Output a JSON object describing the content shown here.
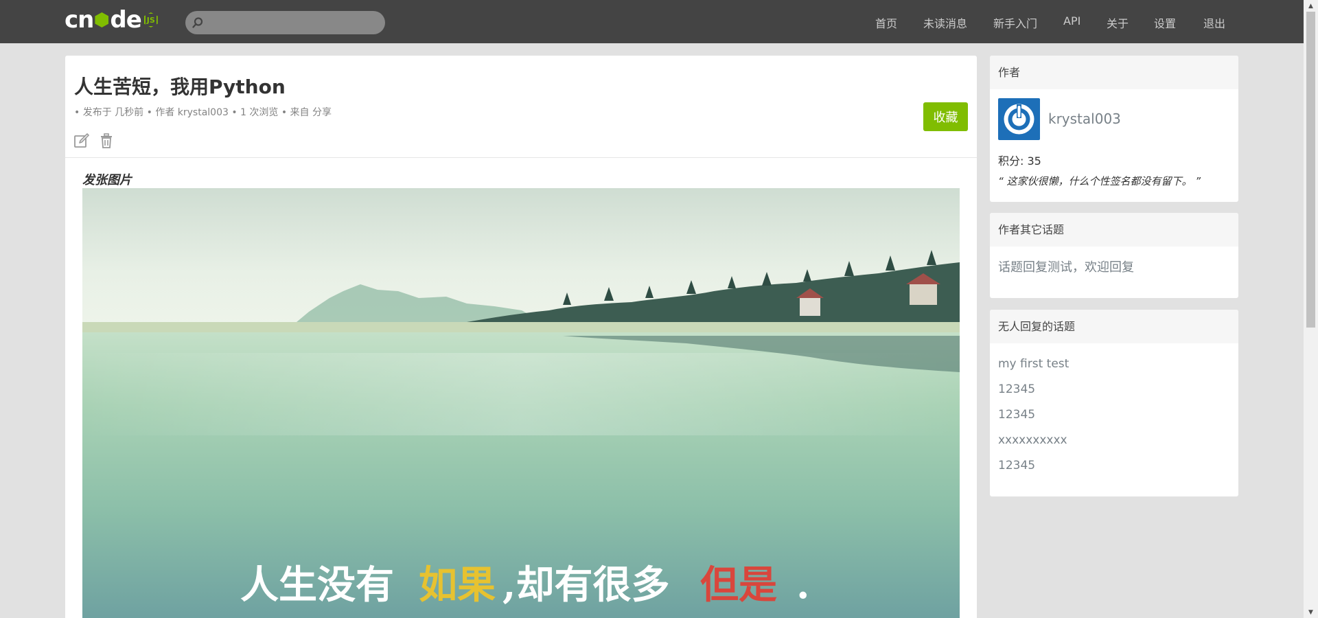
{
  "brand": {
    "logo_text": "cnode",
    "logo_suffix": "JS"
  },
  "search": {
    "placeholder": "",
    "value": ""
  },
  "nav": {
    "items": [
      "首页",
      "未读消息",
      "新手入门",
      "API",
      "关于",
      "设置",
      "退出"
    ]
  },
  "topic": {
    "title": "人生苦短，我用Python",
    "meta": "• 发布于 几秒前 • 作者 krystal003 • 1 次浏览 • 来自 分享",
    "collect_label": "收藏",
    "content_heading": "发张图片",
    "image_caption": {
      "part1": "人生没有",
      "part2": "如果",
      "part3": ",却有很多",
      "part4": "但是",
      "part5": "."
    }
  },
  "sidebar": {
    "author": {
      "header": "作者",
      "name": "krystal003",
      "score": "积分: 35",
      "signature": "“ 这家伙很懒，什么个性签名都没有留下。 ”"
    },
    "other_topics": {
      "header": "作者其它话题",
      "items": [
        "话题回复测试，欢迎回复"
      ]
    },
    "no_reply_topics": {
      "header": "无人回复的话题",
      "items": [
        "my first test",
        "12345",
        "12345",
        "xxxxxxxxxx",
        "12345"
      ]
    }
  },
  "colors": {
    "navbar_bg": "#444444",
    "accent_green": "#80bd01",
    "page_bg": "#e1e1e1",
    "panel_bg": "#ffffff",
    "link_gray": "#778087",
    "avatar_blue": "#1d6fb8"
  },
  "icons": {
    "search": "search-icon",
    "edit": "edit-icon",
    "delete": "trash-icon",
    "avatar": "power-icon"
  }
}
